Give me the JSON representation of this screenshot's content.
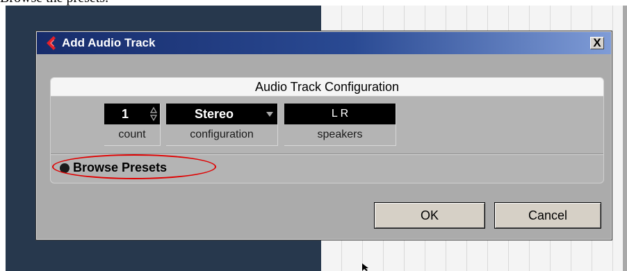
{
  "document": {
    "caption": "Browse the presets."
  },
  "dialog": {
    "title": "Add Audio Track",
    "close_label": "X",
    "panel_title": "Audio Track Configuration",
    "fields": {
      "count": {
        "value": "1",
        "label": "count"
      },
      "configuration": {
        "value": "Stereo",
        "label": "configuration"
      },
      "speakers": {
        "value": "L R",
        "label": "speakers"
      }
    },
    "browse_presets_label": "Browse Presets",
    "ok_label": "OK",
    "cancel_label": "Cancel"
  },
  "icons": {
    "app": "cubase-logo-icon",
    "close": "close-icon",
    "spinner": "spinner-arrows-icon",
    "dropdown": "dropdown-arrow-icon",
    "cursor": "mouse-cursor-icon"
  },
  "colors": {
    "title_bar_start": "#172c6b",
    "title_bar_end": "#7f9cd7",
    "annotation": "#e00000",
    "value_background": "#000000"
  }
}
